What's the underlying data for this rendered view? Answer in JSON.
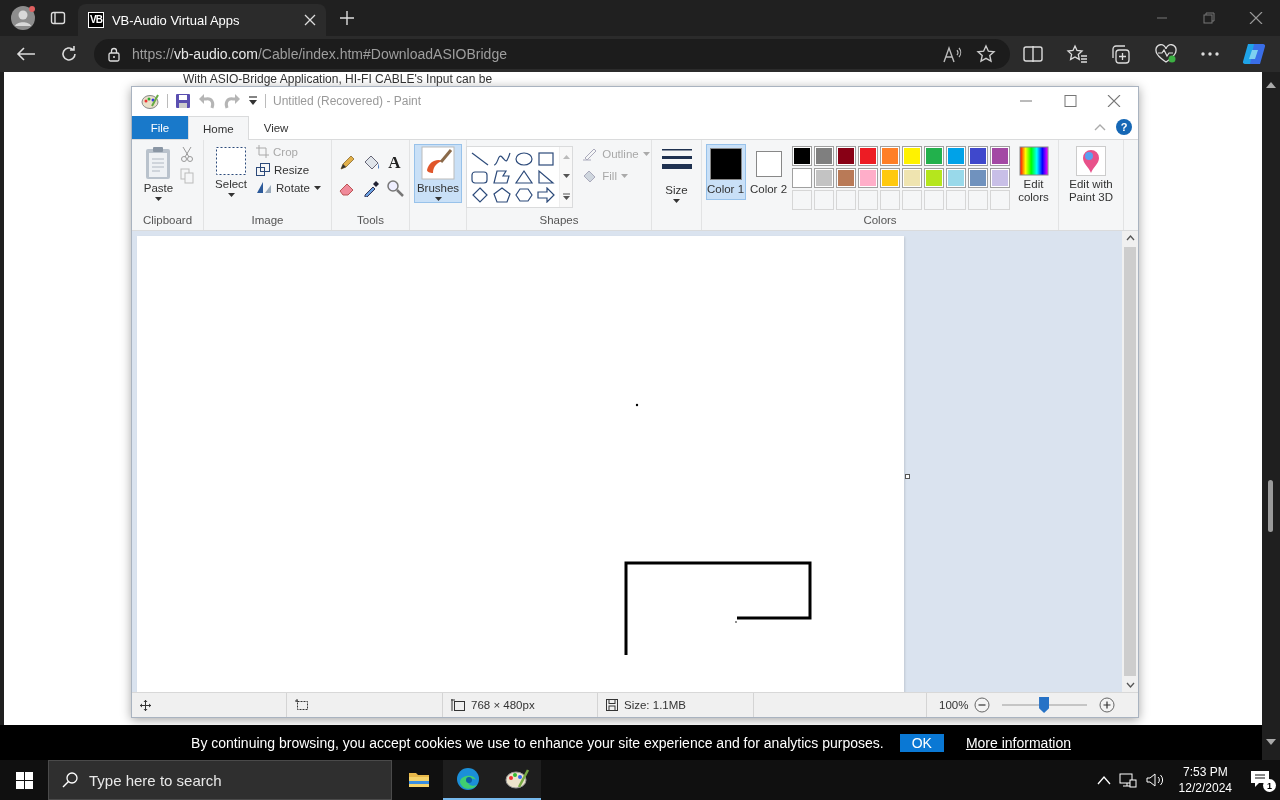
{
  "browser": {
    "tabs": [
      {
        "favicon_text": "VB",
        "title": "VB-Audio Virtual Apps",
        "selected": true
      }
    ],
    "address": {
      "scheme": "https://",
      "host": "vb-audio.com",
      "path": "/Cable/index.htm#DownloadASIOBridge"
    }
  },
  "page": {
    "partial_text": "With ASIO-Bridge Application, HI-FI CABLE's Input can be"
  },
  "paint": {
    "title": "Untitled (Recovered) - Paint",
    "tabs": [
      {
        "label": "File",
        "kind": "file",
        "selected": false
      },
      {
        "label": "Home",
        "kind": "tab",
        "selected": true
      },
      {
        "label": "View",
        "kind": "tab",
        "selected": false
      }
    ],
    "help": "?",
    "ribbon": {
      "clipboard": {
        "label": "Clipboard",
        "paste": "Paste"
      },
      "image": {
        "label": "Image",
        "select": "Select",
        "commands": [
          {
            "label": "Crop",
            "disabled": true
          },
          {
            "label": "Resize",
            "disabled": false
          },
          {
            "label": "Rotate",
            "disabled": false
          }
        ]
      },
      "tools": {
        "label": "Tools",
        "text_glyph": "A"
      },
      "brushes": {
        "label": "Brushes",
        "selected": true
      },
      "shapes": {
        "label": "Shapes",
        "outline": {
          "label": "Outline",
          "disabled": true
        },
        "fill": {
          "label": "Fill",
          "disabled": true
        }
      },
      "size": {
        "label": "Size"
      },
      "colors": {
        "label": "Colors",
        "slots": [
          {
            "label": "Color 1",
            "color": "#000000",
            "selected": true
          },
          {
            "label": "Color 2",
            "color": "#ffffff",
            "selected": false
          }
        ],
        "palette": [
          {
            "color": "#000000"
          },
          {
            "color": "#7f7f7f"
          },
          {
            "color": "#880015"
          },
          {
            "color": "#ed1c24"
          },
          {
            "color": "#ff7f27"
          },
          {
            "color": "#fff200"
          },
          {
            "color": "#22b14c"
          },
          {
            "color": "#00a2e8"
          },
          {
            "color": "#3f48cc"
          },
          {
            "color": "#a349a4"
          },
          {
            "color": "#ffffff"
          },
          {
            "color": "#c3c3c3"
          },
          {
            "color": "#b97a57"
          },
          {
            "color": "#ffaec9"
          },
          {
            "color": "#ffc90e"
          },
          {
            "color": "#efe4b0"
          },
          {
            "color": "#b5e61d"
          },
          {
            "color": "#99d9ea"
          },
          {
            "color": "#7092be"
          },
          {
            "color": "#c8bfe7"
          }
        ],
        "edit": "Edit colors"
      },
      "paint3d": {
        "label": "Edit with Paint 3D"
      }
    },
    "status": {
      "dimensions": "768 × 480px",
      "size": "Size: 1.1MB",
      "zoom": "100%",
      "zoom_slider": {
        "level": 0.49
      }
    }
  },
  "cookie": {
    "text": "By continuing browsing, you accept cookies we use to enhance your site experience and for analytics purposes.",
    "ok": "OK",
    "more": "More information"
  },
  "taskbar": {
    "search_placeholder": "Type here to search",
    "apps": [
      {
        "kind": "explorer",
        "active": false
      },
      {
        "kind": "edge",
        "active": true
      },
      {
        "kind": "paint",
        "active": true
      }
    ],
    "time": "7:53 PM",
    "date": "12/2/2024",
    "notifications": "1"
  }
}
